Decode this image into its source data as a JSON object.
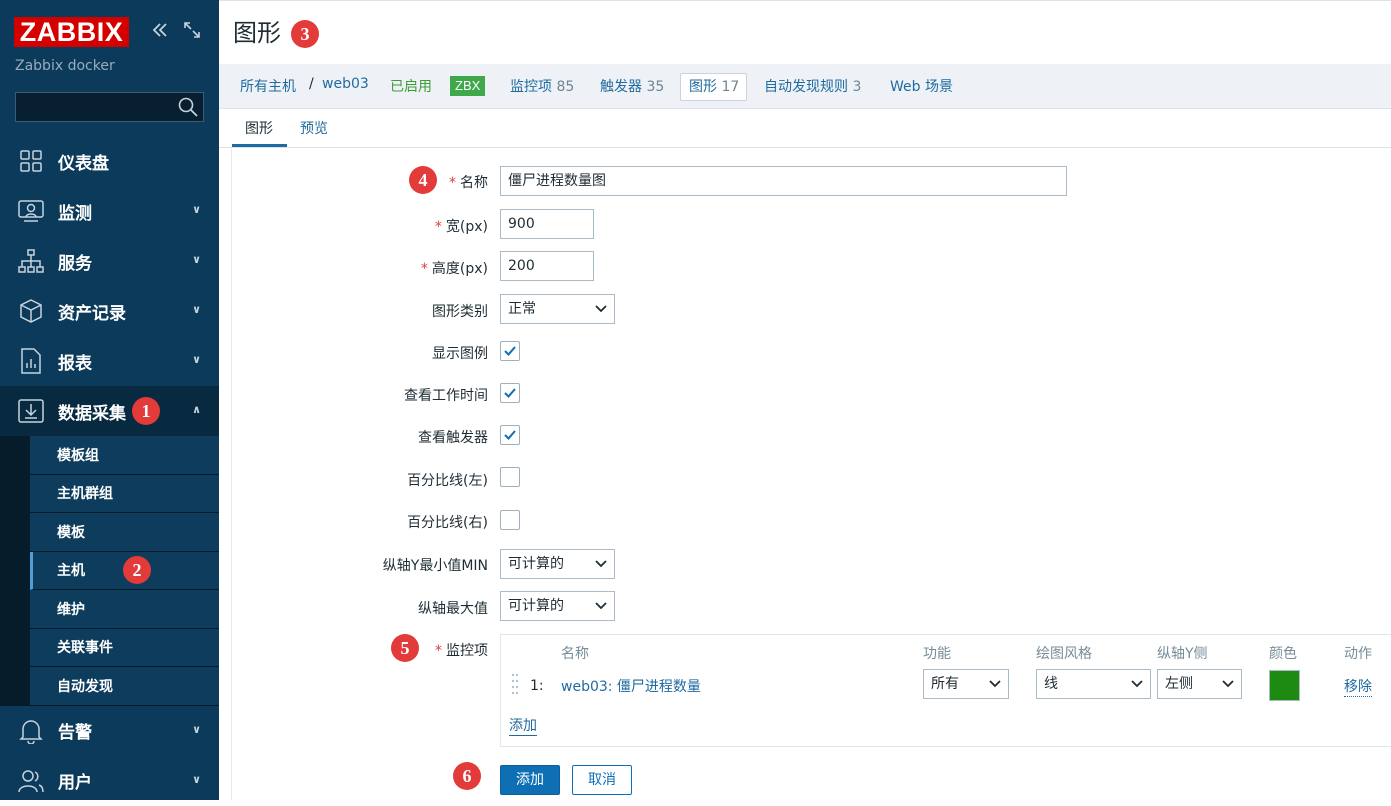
{
  "brand": {
    "logo": "ZABBIX",
    "instance": "Zabbix docker"
  },
  "search": {
    "placeholder": ""
  },
  "menu": {
    "dashboard": "仪表盘",
    "monitoring": "监测",
    "services": "服务",
    "inventory": "资产记录",
    "reports": "报表",
    "data_collection": "数据采集",
    "alerts": "告警",
    "users": "用户"
  },
  "submenu": [
    "模板组",
    "主机群组",
    "模板",
    "主机",
    "维护",
    "关联事件",
    "自动发现"
  ],
  "page": {
    "title": "图形"
  },
  "nav": {
    "all_hosts": "所有主机",
    "separator": "/",
    "host": "web03",
    "status": "已启用",
    "zbx": "ZBX",
    "items_label": "监控项",
    "items_count": "85",
    "triggers_label": "触发器",
    "triggers_count": "35",
    "graphs_label": "图形",
    "graphs_count": "17",
    "discovery_label": "自动发现规则",
    "discovery_count": "3",
    "web_label": "Web 场景"
  },
  "tabs": {
    "graph": "图形",
    "preview": "预览"
  },
  "form": {
    "name_label": "名称",
    "name_value": "僵尸进程数量图",
    "width_label": "宽(px)",
    "width_value": "900",
    "height_label": "高度(px)",
    "height_value": "200",
    "graph_type_label": "图形类别",
    "graph_type_value": "正常",
    "show_legend_label": "显示图例",
    "show_working_time_label": "查看工作时间",
    "show_triggers_label": "查看触发器",
    "percentile_left_label": "百分比线(左)",
    "percentile_right_label": "百分比线(右)",
    "ymin_label": "纵轴Y最小值MIN",
    "ymin_value": "可计算的",
    "ymax_label": "纵轴最大值",
    "ymax_value": "可计算的",
    "items_label": "监控项",
    "required_mark": "*"
  },
  "checkboxes": {
    "show_legend": true,
    "show_working_time": true,
    "show_triggers": true,
    "percentile_left": false,
    "percentile_right": false
  },
  "items_table": {
    "headers": {
      "name": "名称",
      "function": "功能",
      "draw_style": "绘图风格",
      "y_axis_side": "纵轴Y侧",
      "color": "颜色",
      "action": "动作"
    },
    "rows": [
      {
        "num": "1:",
        "name": "web03: 僵尸进程数量",
        "function": "所有",
        "draw_style": "线",
        "y_axis_side": "左侧",
        "color": "#1d8a12",
        "action": "移除"
      }
    ],
    "add_link": "添加"
  },
  "buttons": {
    "add": "添加",
    "cancel": "取消"
  },
  "badges": [
    "1",
    "2",
    "3",
    "4",
    "5",
    "6"
  ],
  "colors": {
    "sidebar": "#0b3a5a",
    "accent": "#0f6fb5",
    "badge": "#e33a3a",
    "logo": "#d40000"
  }
}
